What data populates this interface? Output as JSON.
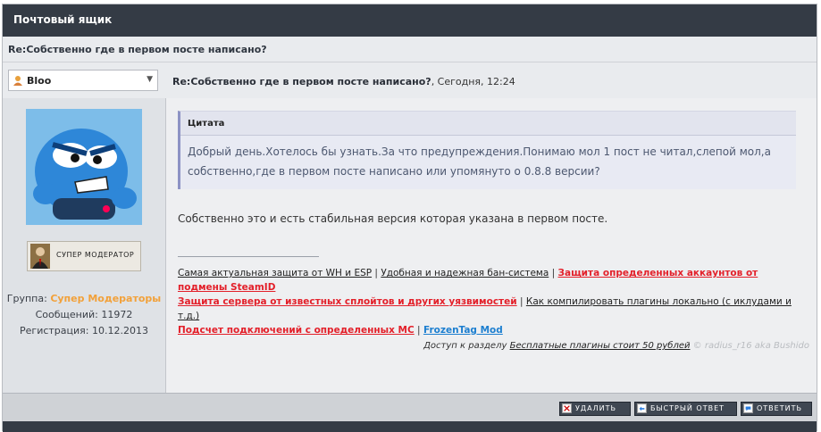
{
  "window": {
    "title": "Почтовый ящик"
  },
  "subject": "Re:Собственно где в первом посте написано?",
  "post": {
    "username": "Bloo",
    "title": "Re:Собственно где в первом посте написано?",
    "date": ", Сегодня, 12:24"
  },
  "user": {
    "rank_label": "СУПЕР МОДЕРАТОР",
    "group_label": "Группа: ",
    "group_value": "Супер Модераторы",
    "messages": "Сообщений: 11972",
    "registration": "Регистрация: 10.12.2013"
  },
  "quote": {
    "header": "Цитата",
    "text": "Добрый день.Хотелось бы узнать.За что предупреждения.Понимаю мол 1 пост не читал,слепой мол,а собственно,где в первом посте написано или упомянуто о 0.8.8 версии?"
  },
  "message": "Собственно это и есть стабильная версия которая указана в первом посте.",
  "signature": {
    "links": [
      "Самая актуальная защита от WH и ESP",
      "Удобная и надежная бан-система",
      "Защита определенных аккаунтов от подмены SteamID",
      "Защита сервера от известных сплойтов и других уязвимостей",
      "Как компилировать плагины локально (с иклудами и т.д.)",
      "Подсчет подключений с определенных MC",
      "FrozenTag Mod"
    ],
    "separator": "|",
    "access_prefix": "Доступ к разделу",
    "access_link": "Бесплатные плагины стоит 50 рублей",
    "credit": "© radius_r16 aka Bushido"
  },
  "buttons": {
    "delete": "УДАЛИТЬ",
    "quick_reply": "БЫСТРЫЙ ОТВЕТ",
    "reply": "ОТВЕТИТЬ"
  },
  "colors": {
    "accent_orange": "#f2a13a",
    "link_red": "#e3202a",
    "link_blue": "#1d7fd0",
    "header_dark": "#343b45"
  }
}
